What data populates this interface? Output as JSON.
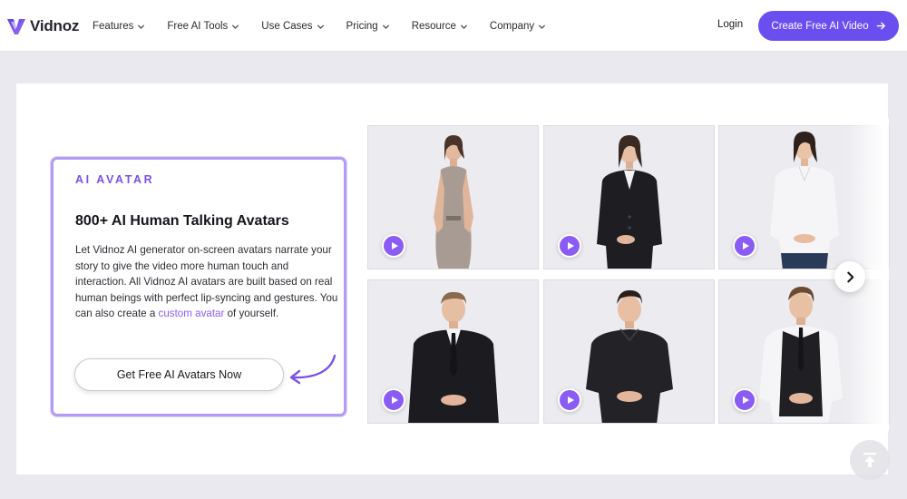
{
  "header": {
    "logo_text": "Vidnoz",
    "nav": [
      {
        "label": "Features"
      },
      {
        "label": "Free AI Tools"
      },
      {
        "label": "Use Cases"
      },
      {
        "label": "Pricing"
      },
      {
        "label": "Resource"
      },
      {
        "label": "Company"
      }
    ],
    "login_label": "Login",
    "cta_label": "Create Free AI Video"
  },
  "card": {
    "eyebrow": "AI AVATAR",
    "title": "800+ AI Human Talking Avatars",
    "body_before": "Let Vidnoz AI generator on-screen avatars narrate your story to give the video more human touch and interaction. All Vidnoz AI avatars are built based on real human beings with perfect lip-syncing and gestures. You can also create a ",
    "body_link": "custom avatar",
    "body_after": " of yourself.",
    "button_label": "Get Free AI Avatars Now"
  },
  "avatars": [
    {
      "outfit": "grey-halter-dress",
      "gender": "female"
    },
    {
      "outfit": "black-blazer",
      "gender": "female"
    },
    {
      "outfit": "white-blouse-jeans",
      "gender": "female"
    },
    {
      "outfit": "black-suit-tie",
      "gender": "male"
    },
    {
      "outfit": "black-polo",
      "gender": "male"
    },
    {
      "outfit": "vest-white-shirt",
      "gender": "male"
    }
  ],
  "colors": {
    "brand": "#6b4ef0",
    "accent": "#8a5cf5",
    "card_border": "#b49cf6",
    "page_bg": "#e9e9ef"
  },
  "icons": {
    "play": "play-icon",
    "next": "chevron-right-icon",
    "back_to_top": "back-to-top-icon",
    "cta_arrow": "arrow-right-icon"
  }
}
